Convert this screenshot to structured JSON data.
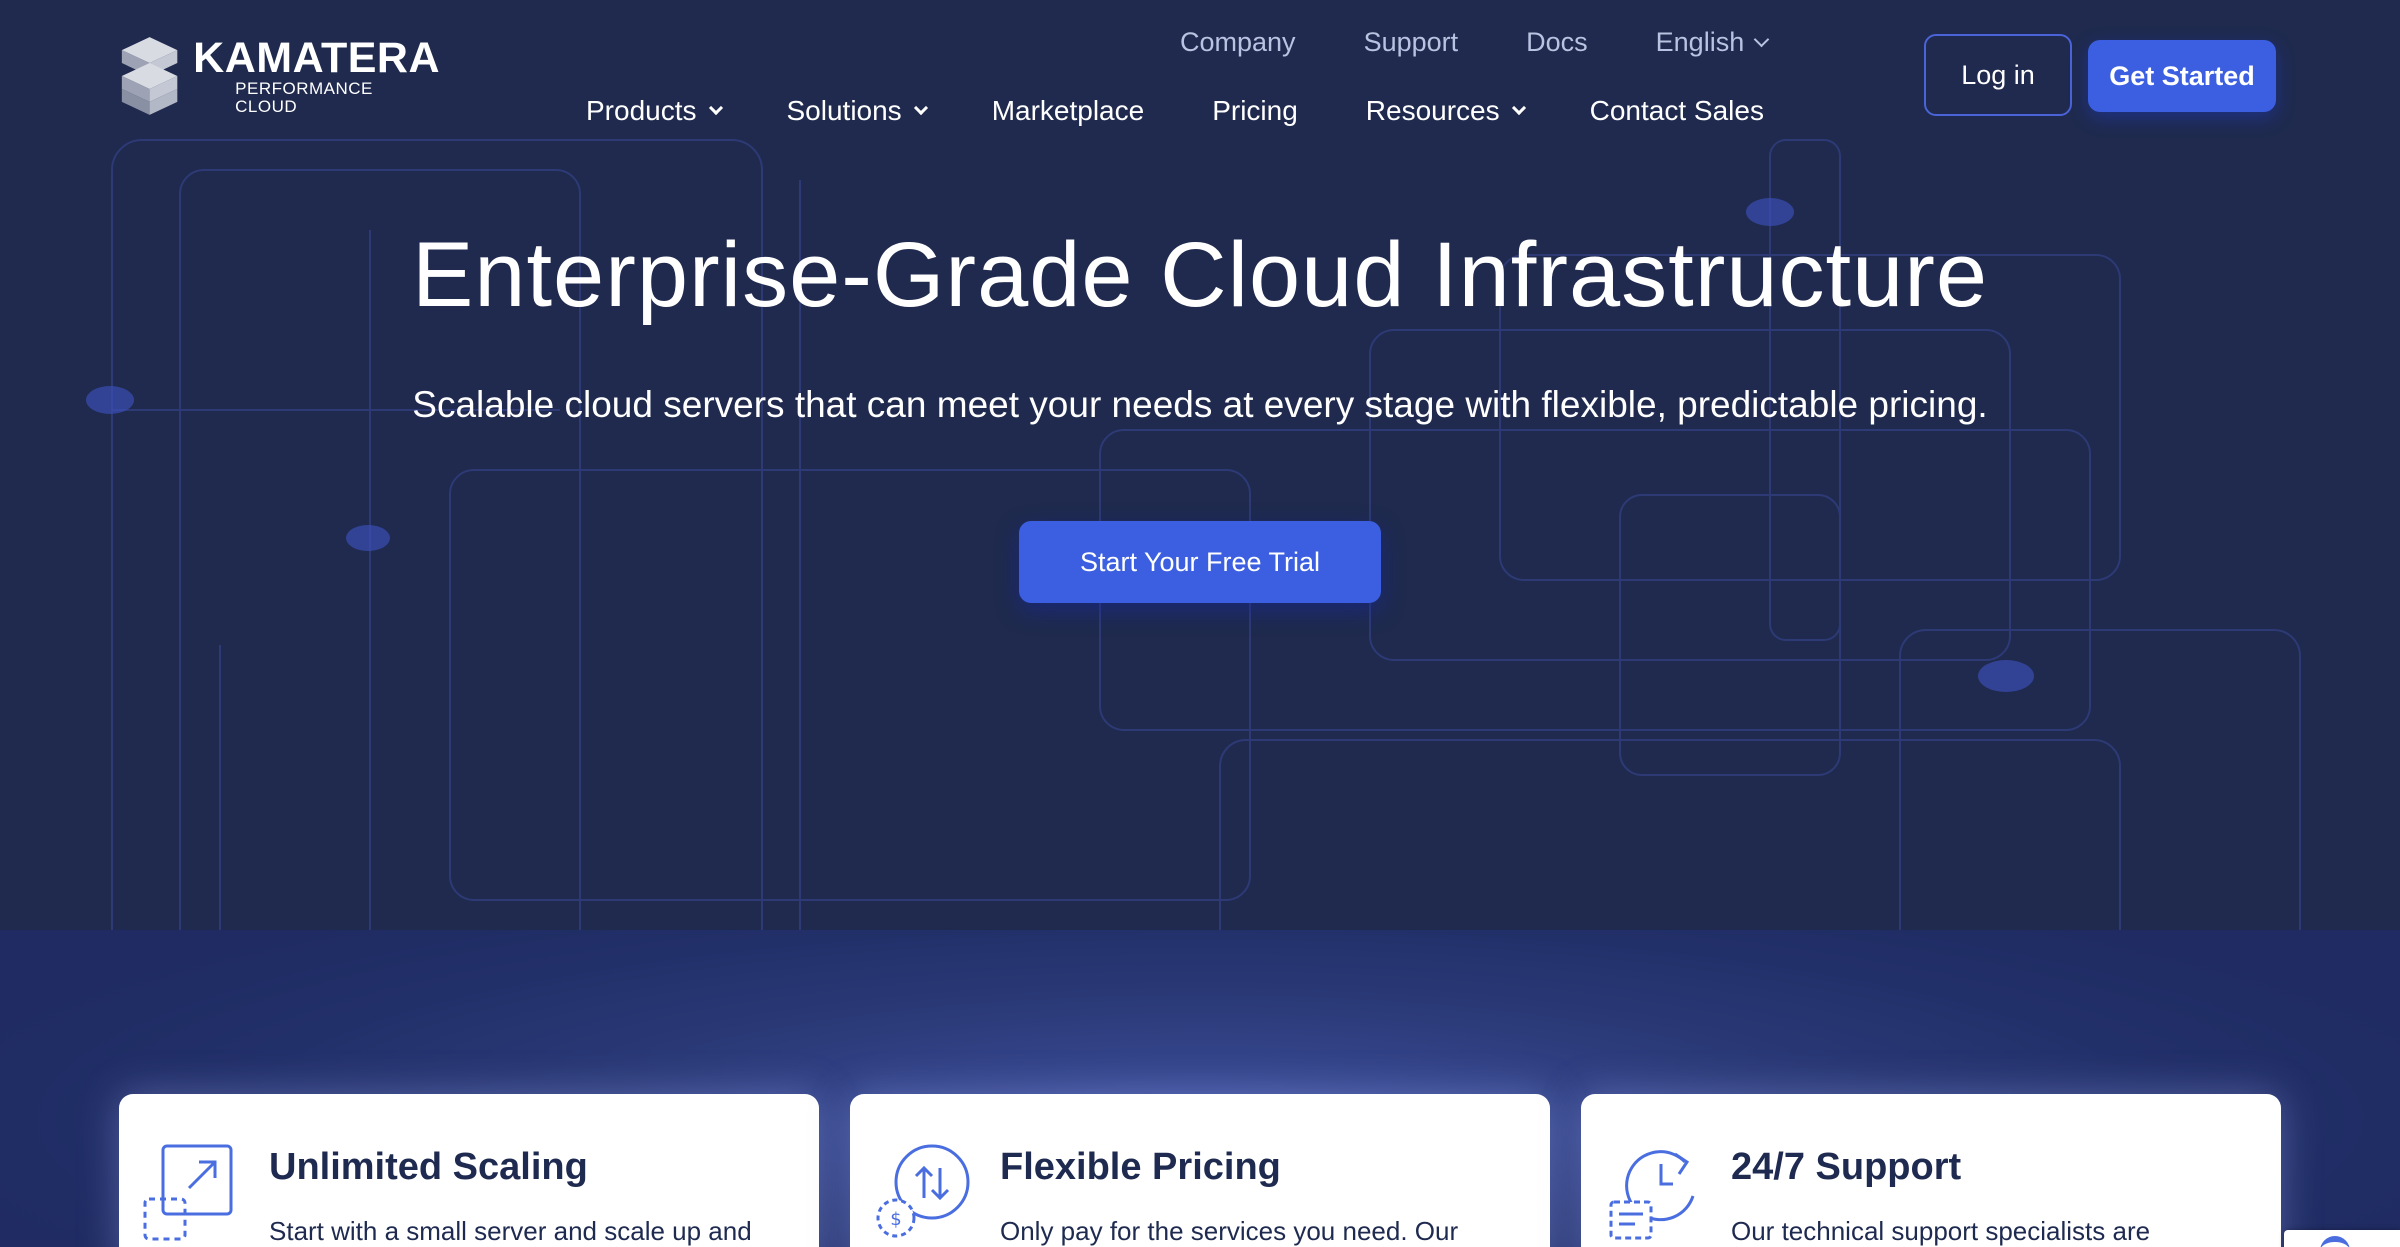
{
  "brand": {
    "name": "KAMATERA",
    "tagline": "PERFORMANCE CLOUD"
  },
  "top_links": [
    "Company",
    "Support",
    "Docs"
  ],
  "language": "English",
  "main_nav": [
    {
      "label": "Products",
      "dropdown": true
    },
    {
      "label": "Solutions",
      "dropdown": true
    },
    {
      "label": "Marketplace",
      "dropdown": false
    },
    {
      "label": "Pricing",
      "dropdown": false
    },
    {
      "label": "Resources",
      "dropdown": true
    },
    {
      "label": "Contact Sales",
      "dropdown": false
    }
  ],
  "buttons": {
    "login": "Log in",
    "get_started": "Get Started",
    "trial": "Start Your Free Trial"
  },
  "hero": {
    "title": "Enterprise-Grade Cloud Infrastructure",
    "subtitle": "Scalable cloud servers that can meet your needs at every stage with flexible, predictable pricing."
  },
  "features": [
    {
      "icon": "scaling-icon",
      "title": "Unlimited Scaling",
      "text": "Start with a small server and scale up and"
    },
    {
      "icon": "pricing-icon",
      "title": "Flexible Pricing",
      "text": "Only pay for the services you need. Our"
    },
    {
      "icon": "support-icon",
      "title": "24/7 Support",
      "text": "Our technical support specialists are"
    }
  ],
  "colors": {
    "background": "#1f2a4e",
    "accent": "#3b5fe0",
    "card_text": "#1e2a4f",
    "muted_link": "#b9c2e0"
  }
}
